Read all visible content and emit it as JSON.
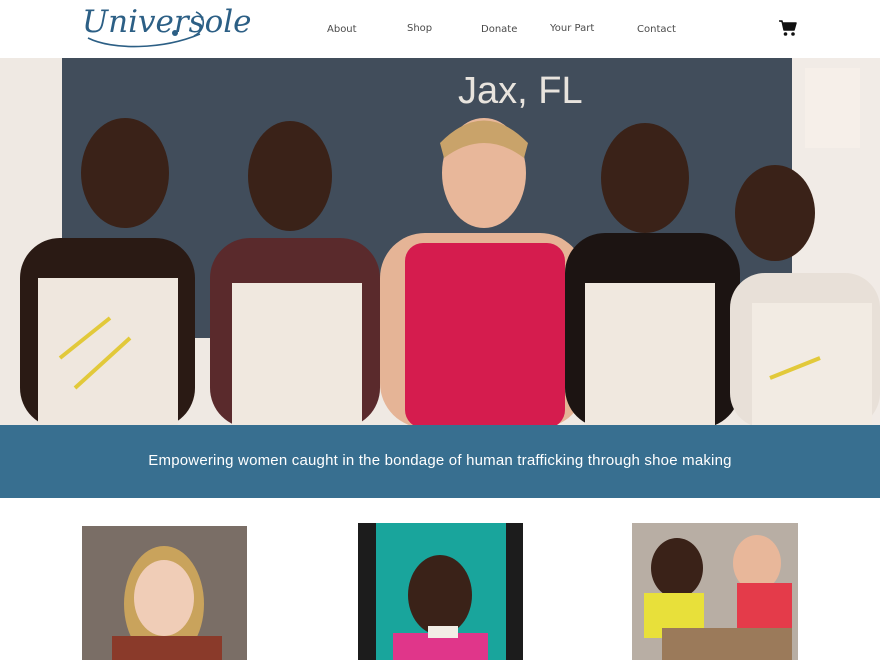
{
  "brand": {
    "logo_text": "Universole",
    "accent": "#2c5f85"
  },
  "nav": {
    "items": [
      "About",
      "Shop",
      "Donate",
      "Your Part",
      "Contact"
    ],
    "cart_icon": "shopping-cart-icon"
  },
  "hero": {
    "chalkboard_text": "Jax, FL"
  },
  "banner": {
    "text": "Empowering women caught in the bondage of human trafficking through shoe making",
    "color": "#386f90"
  }
}
